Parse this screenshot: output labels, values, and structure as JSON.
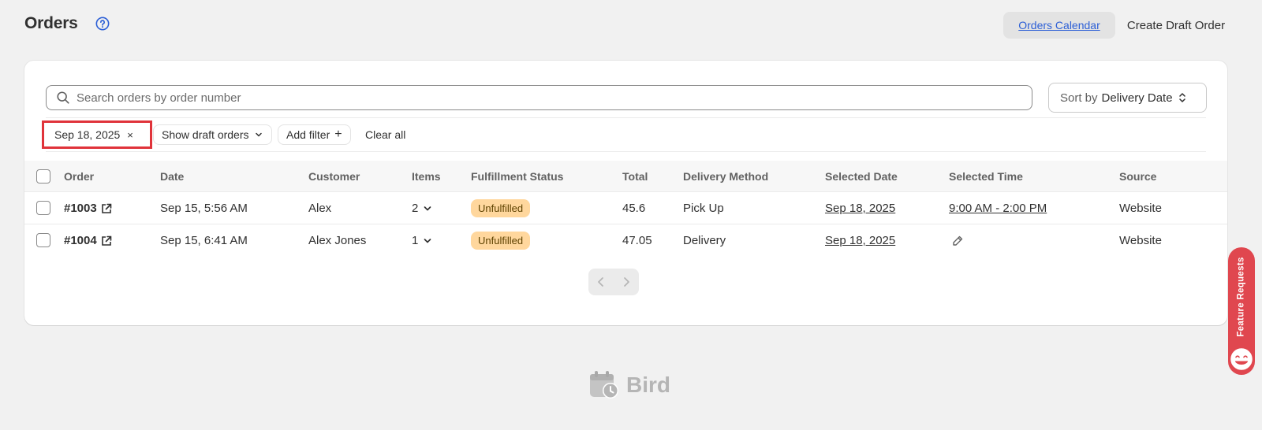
{
  "page": {
    "title": "Orders"
  },
  "header": {
    "calendar_label": "Orders Calendar",
    "create_draft_label": "Create Draft Order"
  },
  "search": {
    "placeholder": "Search orders by order number",
    "value": ""
  },
  "sort": {
    "prefix": "Sort by",
    "value": "Delivery Date"
  },
  "filters": {
    "date_chip": "Sep 18, 2025",
    "date_chip_remove": "×",
    "draft_label": "Show draft orders",
    "add_filter_label": "Add filter",
    "add_filter_plus": "+",
    "clear_all_label": "Clear all"
  },
  "table": {
    "columns": [
      "Order",
      "Date",
      "Customer",
      "Items",
      "Fulfillment Status",
      "Total",
      "Delivery Method",
      "Selected Date",
      "Selected Time",
      "Source"
    ],
    "rows": [
      {
        "order": "#1003",
        "date": "Sep 15, 5:56 AM",
        "customer": "Alex",
        "items": "2",
        "fulfillment": "Unfulfilled",
        "total": "45.6",
        "delivery_method": "Pick Up",
        "selected_date": "Sep 18, 2025",
        "selected_time": "9:00 AM - 2:00 PM",
        "source": "Website"
      },
      {
        "order": "#1004",
        "date": "Sep 15, 6:41 AM",
        "customer": "Alex Jones",
        "items": "1",
        "fulfillment": "Unfulfilled",
        "total": "47.05",
        "delivery_method": "Delivery",
        "selected_date": "Sep 18, 2025",
        "selected_time": "",
        "source": "Website"
      }
    ]
  },
  "brand": {
    "name": "Bird"
  },
  "feature_tab": {
    "label": "Feature Requests"
  },
  "colors": {
    "accent_link": "#2c5fd6",
    "badge_bg": "#ffd79d",
    "highlight": "#e0333a",
    "feature_tab": "#e0474f"
  }
}
